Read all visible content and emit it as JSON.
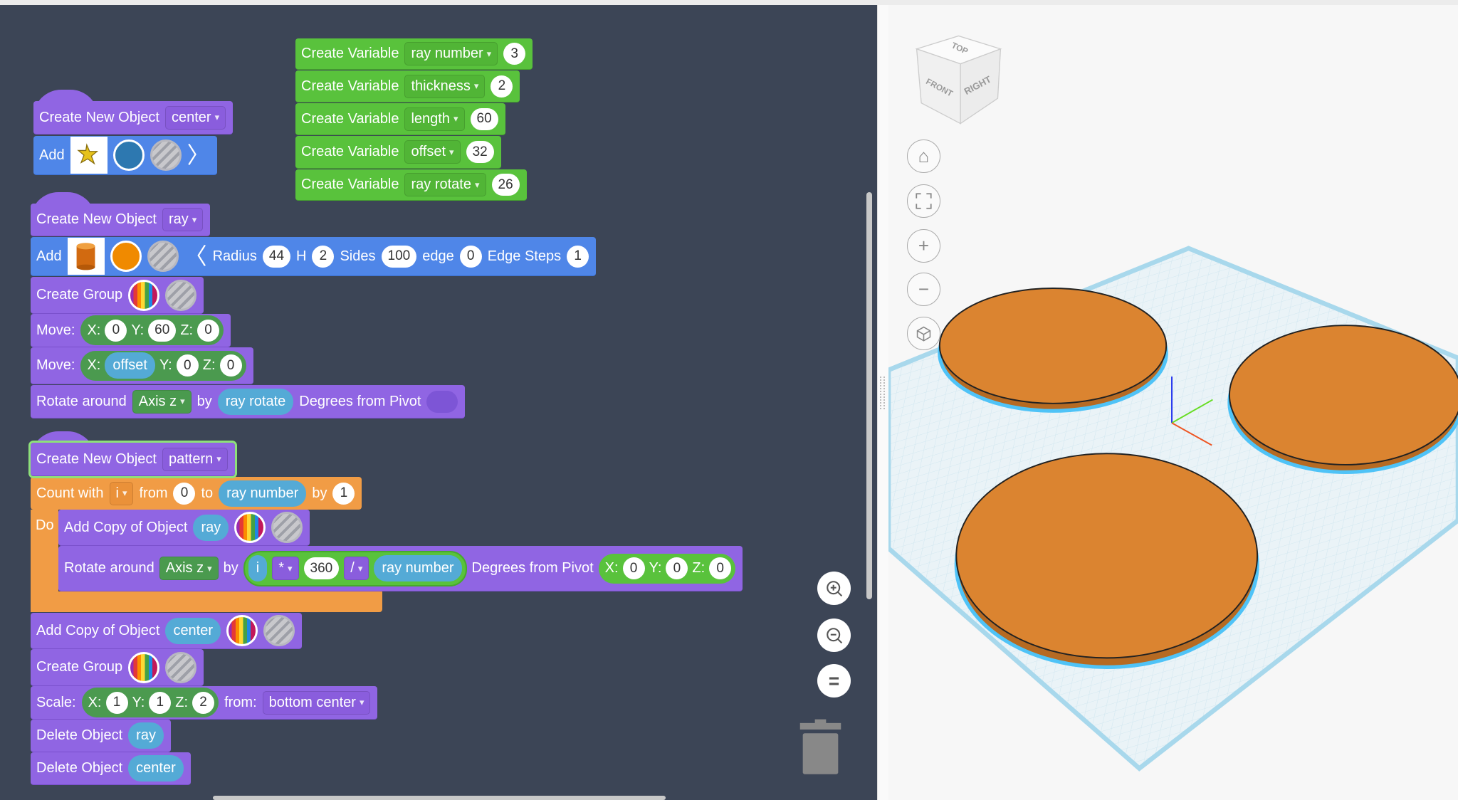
{
  "colors": {
    "workspace": "#3c4556",
    "object_block": "#9065e3",
    "add_block": "#4f86e8",
    "variable_block": "#59c23c",
    "loop_block": "#f19c45",
    "variable_pill": "#54aad6",
    "shape_orange": "#db8430"
  },
  "variables": [
    {
      "label": "Create Variable",
      "name": "ray number",
      "value": "3"
    },
    {
      "label": "Create Variable",
      "name": "thickness",
      "value": "2"
    },
    {
      "label": "Create Variable",
      "name": "length",
      "value": "60"
    },
    {
      "label": "Create Variable",
      "name": "offset",
      "value": "32"
    },
    {
      "label": "Create Variable",
      "name": "ray rotate",
      "value": "26"
    }
  ],
  "center": {
    "create_label": "Create New Object",
    "name": "center",
    "add_label": "Add",
    "shape_icon": "star-shape-icon",
    "color": "#2d78b0"
  },
  "ray": {
    "create_label": "Create New Object",
    "name": "ray",
    "add_label": "Add",
    "shape_icon": "cylinder-shape-icon",
    "color": "#f08a00",
    "params": {
      "radius_label": "Radius",
      "radius": "44",
      "h_label": "H",
      "h": "2",
      "sides_label": "Sides",
      "sides": "100",
      "edge_label": "edge",
      "edge": "0",
      "steps_label": "Edge Steps",
      "steps": "1"
    },
    "group_label": "Create Group",
    "move1": {
      "label": "Move:",
      "x_label": "X:",
      "x": "0",
      "y_label": "Y:",
      "y": "60",
      "z_label": "Z:",
      "z": "0"
    },
    "move2": {
      "label": "Move:",
      "x_label": "X:",
      "x": "offset",
      "y_label": "Y:",
      "y": "0",
      "z_label": "Z:",
      "z": "0"
    },
    "rotate": {
      "label": "Rotate around",
      "axis": "Axis z",
      "by": "by",
      "amount": "ray rotate",
      "pivot_label": "Degrees from Pivot"
    }
  },
  "pattern": {
    "create_label": "Create New Object",
    "name": "pattern",
    "count": {
      "label": "Count with",
      "var": "i",
      "from": "from",
      "from_val": "0",
      "to": "to",
      "to_val": "ray number",
      "by": "by",
      "by_val": "1",
      "do": "Do"
    },
    "copy_ray": {
      "label": "Add Copy of Object",
      "object": "ray"
    },
    "rotate": {
      "label": "Rotate around",
      "axis": "Axis z",
      "by": "by",
      "i": "i",
      "op1": "*",
      "num": "360",
      "op2": "/",
      "divisor": "ray number",
      "pivot_label": "Degrees from Pivot",
      "x_label": "X:",
      "x": "0",
      "y_label": "Y:",
      "y": "0",
      "z_label": "Z:",
      "z": "0"
    },
    "copy_center": {
      "label": "Add Copy of Object",
      "object": "center"
    },
    "group_label": "Create Group",
    "scale": {
      "label": "Scale:",
      "x_label": "X:",
      "x": "1",
      "y_label": "Y:",
      "y": "1",
      "z_label": "Z:",
      "z": "2",
      "from": "from:",
      "from_val": "bottom center"
    },
    "delete1": {
      "label": "Delete Object",
      "object": "ray"
    },
    "delete2": {
      "label": "Delete Object",
      "object": "center"
    }
  },
  "viewcube": {
    "top": "TOP",
    "front": "FRONT",
    "right": "RIGHT"
  },
  "nav_icons": [
    "home-icon",
    "fit-view-icon",
    "zoom-in-icon",
    "zoom-out-icon",
    "ortho-view-icon"
  ],
  "workspace_controls": [
    "zoom-in-icon",
    "zoom-out-icon",
    "reset-zoom-icon",
    "trash-icon"
  ]
}
